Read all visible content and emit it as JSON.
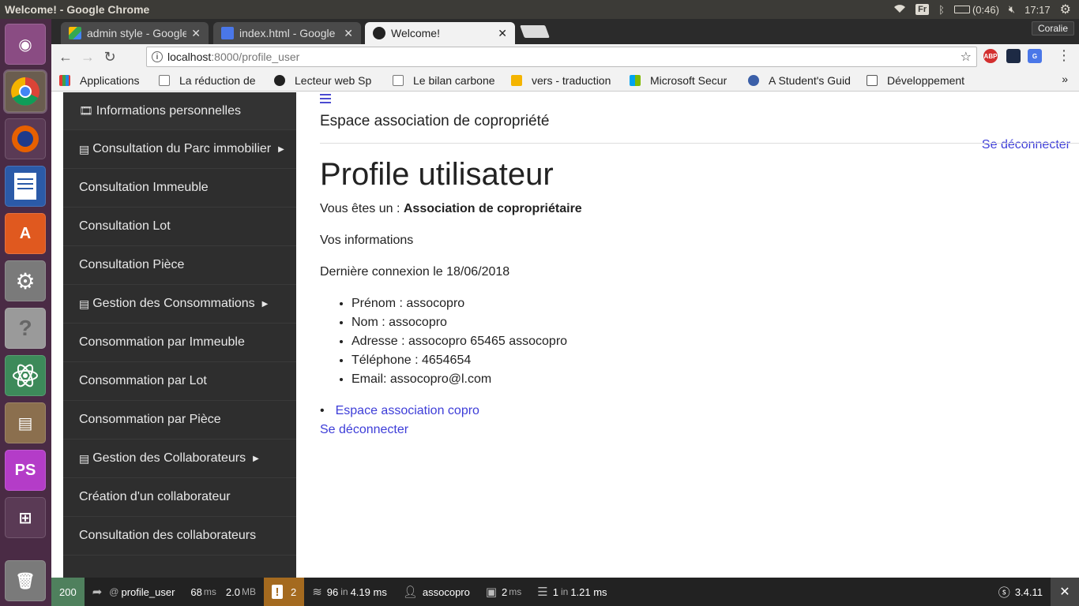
{
  "window_title": "Welcome! - Google Chrome",
  "system": {
    "keyboard_layout": "Fr",
    "battery": "(0:46)",
    "time": "17:17",
    "profile_name": "Coralie"
  },
  "tabs": [
    {
      "label": "admin style - Google",
      "icon": "google-drive-icon",
      "active": false
    },
    {
      "label": "index.html - Google",
      "icon": "google-docs-icon",
      "active": false
    },
    {
      "label": "Welcome!",
      "icon": "symfony-icon",
      "active": true
    }
  ],
  "address": {
    "host": "localhost",
    "path": ":8000/profile_user"
  },
  "bookmarks": [
    {
      "label": "Applications",
      "icon": "apps-grid-icon"
    },
    {
      "label": "La réduction de",
      "icon": "page-icon"
    },
    {
      "label": "Lecteur web Sp",
      "icon": "spotify-icon"
    },
    {
      "label": "Le bilan carbone",
      "icon": "page-icon"
    },
    {
      "label": "vers - traduction",
      "icon": "wordreference-icon"
    },
    {
      "label": "Microsoft Secur",
      "icon": "windows-icon"
    },
    {
      "label": "A Student's Guid",
      "icon": "globe-icon"
    },
    {
      "label": "Développement",
      "icon": "r-icon"
    }
  ],
  "sidebar": {
    "items": [
      {
        "label": "Informations personnelles",
        "icon": "film-icon",
        "section": true,
        "caret": false
      },
      {
        "label": "Consultation du Parc immobilier",
        "icon": "book-icon",
        "section": true,
        "caret": true
      },
      {
        "label": "Consultation Immeuble",
        "section": false
      },
      {
        "label": "Consultation Lot",
        "section": false
      },
      {
        "label": "Consultation Pièce",
        "section": false
      },
      {
        "label": "Gestion des Consommations",
        "icon": "book-icon",
        "section": true,
        "caret": true
      },
      {
        "label": "Consommation par Immeuble",
        "section": false
      },
      {
        "label": "Consommation par Lot",
        "section": false
      },
      {
        "label": "Consommation par Pièce",
        "section": false
      },
      {
        "label": "Gestion des Collaborateurs",
        "icon": "book-icon",
        "section": true,
        "caret": true
      },
      {
        "label": "Création d'un collaborateur",
        "section": false
      },
      {
        "label": "Consultation des collaborateurs",
        "section": false
      }
    ]
  },
  "page": {
    "brand": "Espace association de copropriété",
    "logout_top": "Se déconnecter",
    "title": "Profile utilisateur",
    "role_prefix": "Vous êtes un : ",
    "role_value": "Association de copropriétaire",
    "info_heading": "Vos informations",
    "last_login": "Dernière connexion le 18/06/2018",
    "details": [
      "Prénom : assocopro",
      "Nom : assocopro",
      "Adresse : assocopro 65465 assocopro",
      "Téléphone : 4654654",
      "Email: assocopro@l.com"
    ],
    "link_space": "Espace association copro",
    "link_logout": "Se déconnecter"
  },
  "debug_toolbar": {
    "status": "200",
    "route": "profile_user",
    "time_value": "68",
    "time_unit": "ms",
    "memory_value": "2.0",
    "memory_unit": "MB",
    "log_count": "2",
    "twig_count": "96",
    "twig_in": "in",
    "twig_time": "4.19 ms",
    "user": "assocopro",
    "form_time": "2",
    "form_unit": "ms",
    "db_count": "1",
    "db_in": "in",
    "db_time": "1.21 ms",
    "symfony_version": "3.4.11"
  },
  "colors": {
    "accent_link": "#3d3dd8",
    "status_ok": "#4f805d",
    "warning": "#a46a1f"
  }
}
